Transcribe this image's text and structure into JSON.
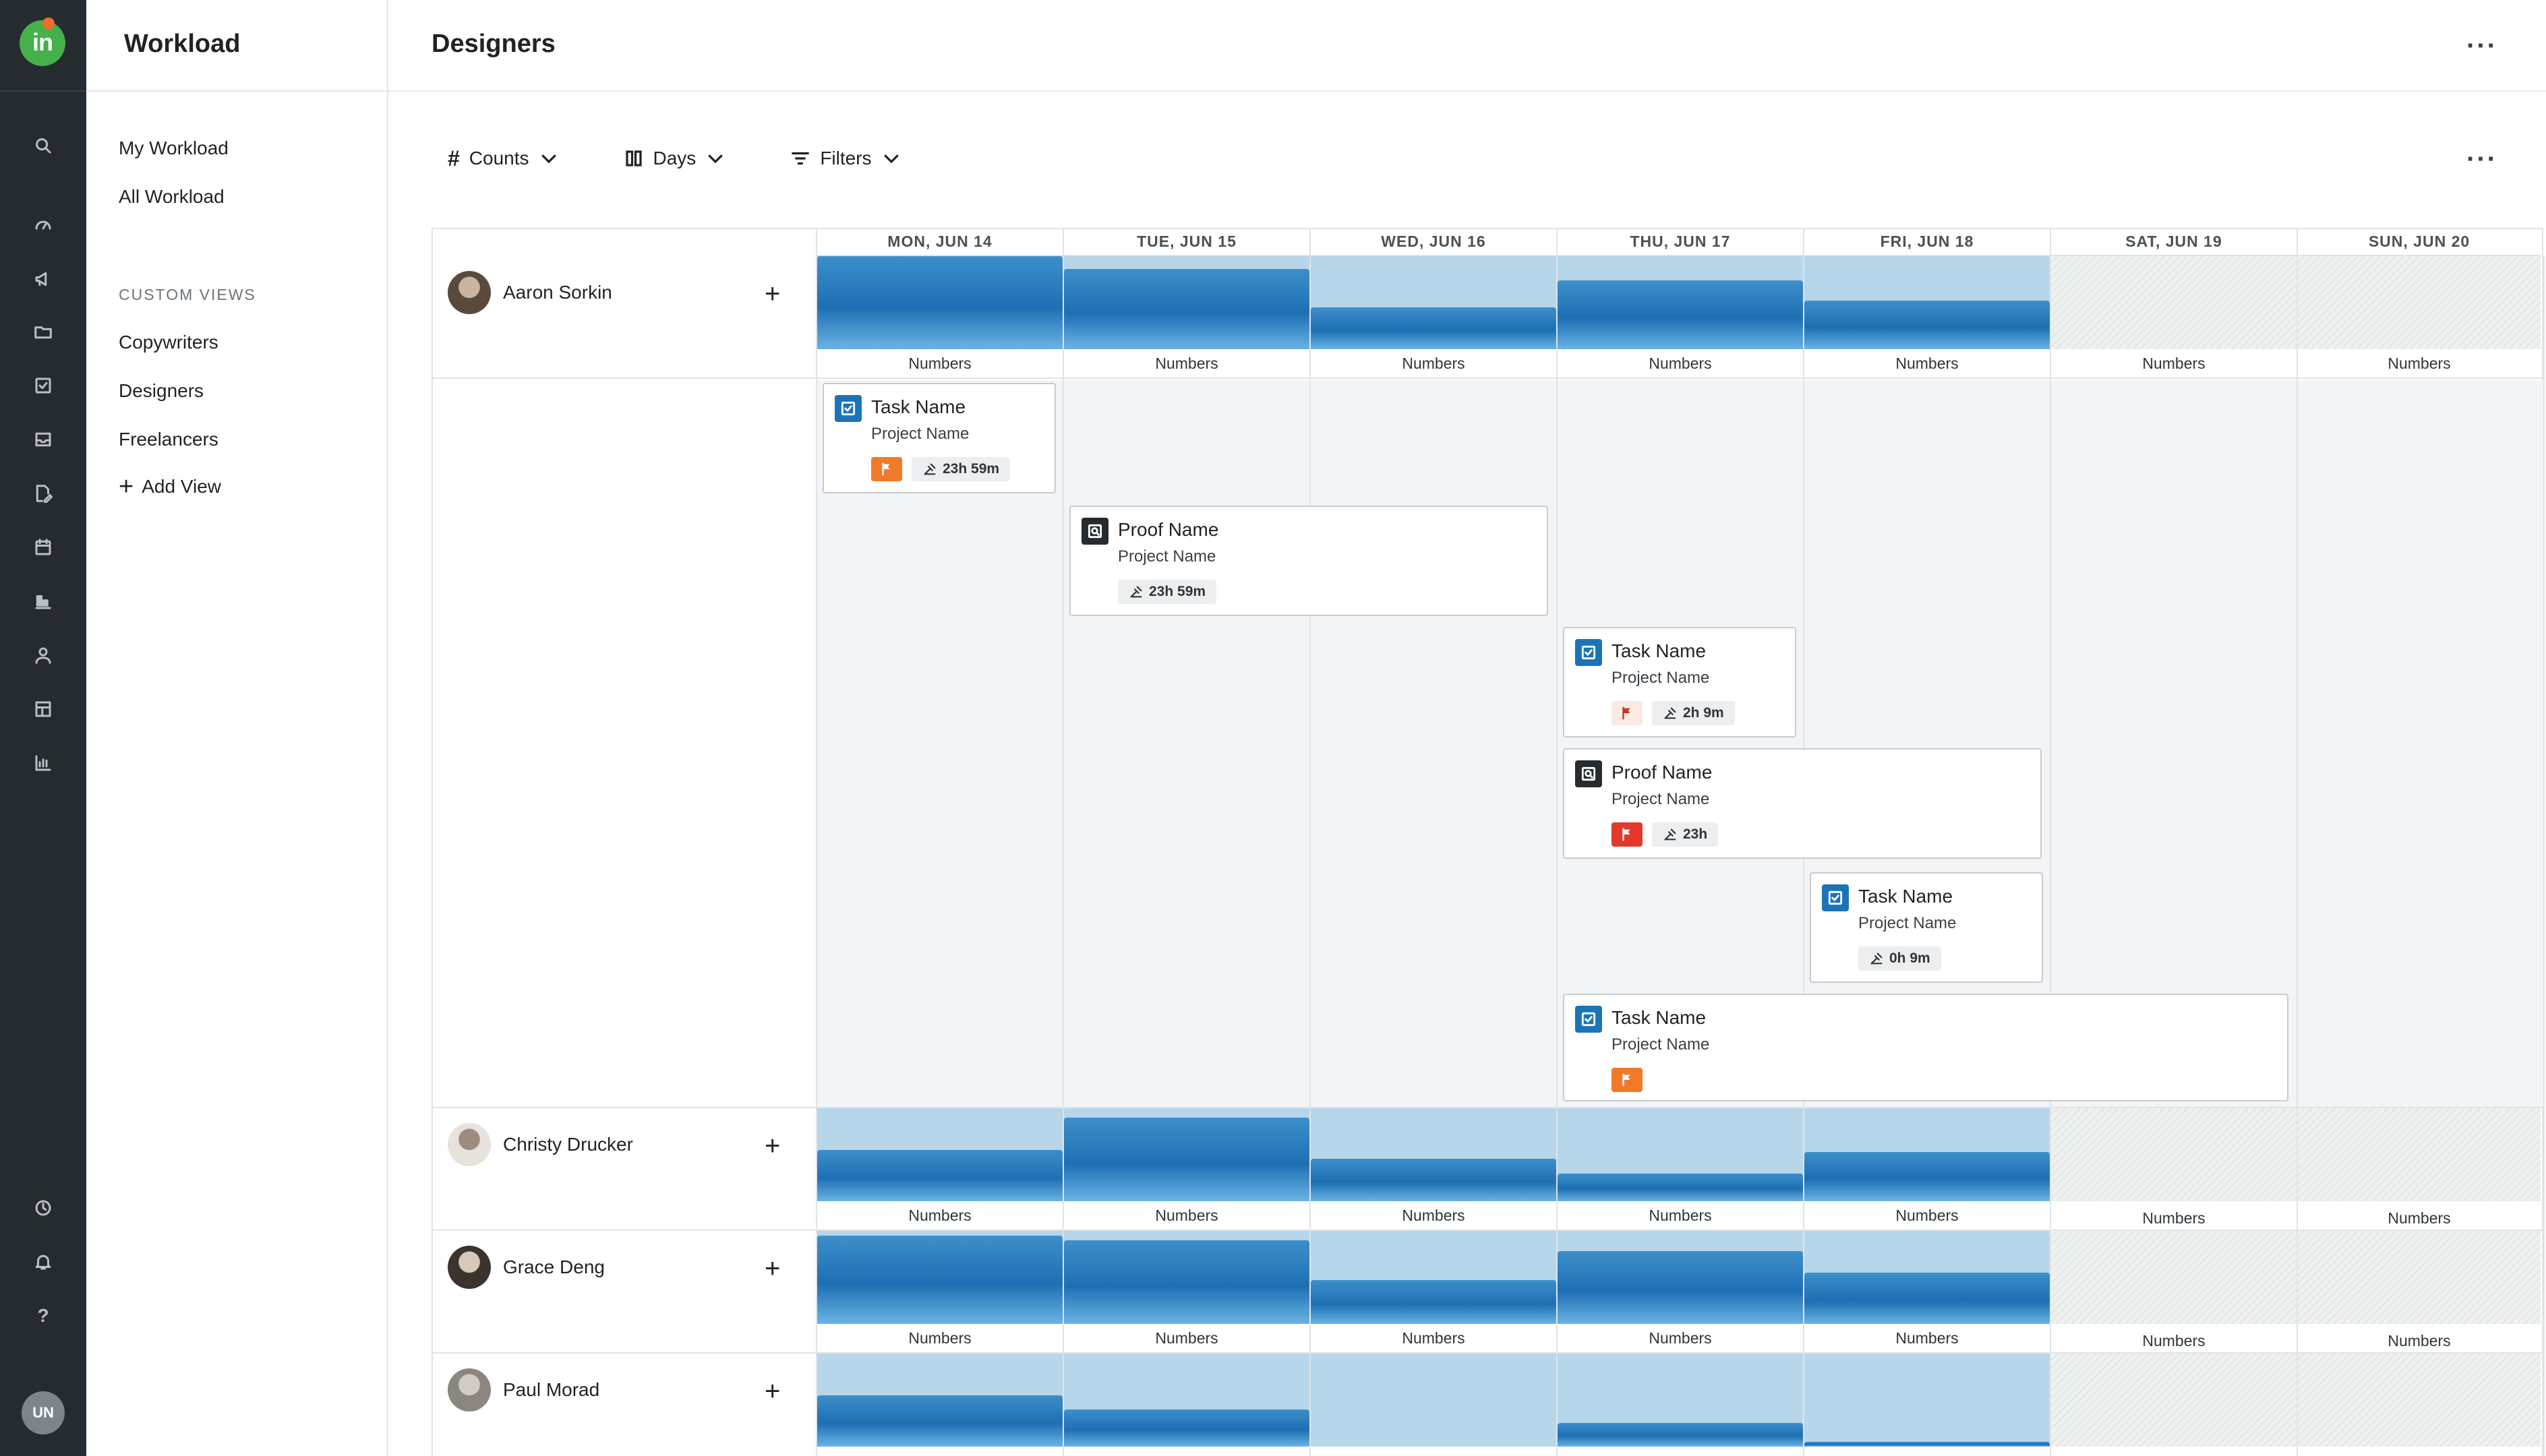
{
  "app": {
    "logo_text": "in"
  },
  "rail": {
    "icons": [
      "search-icon",
      "dashboard-icon",
      "megaphone-icon",
      "folder-icon",
      "task-check-icon",
      "inbox-icon",
      "proof-edit-icon",
      "calendar-icon",
      "workload-icon",
      "person-icon",
      "layout-icon",
      "reports-icon"
    ],
    "bottom_icons": [
      "clock-icon",
      "bell-icon",
      "help-icon"
    ],
    "help_glyph": "?",
    "user_initials": "UN"
  },
  "sidebar": {
    "title": "Workload",
    "items": [
      {
        "label": "My Workload"
      },
      {
        "label": "All Workload"
      }
    ],
    "section_label": "CUSTOM VIEWS",
    "views": [
      {
        "label": "Copywriters"
      },
      {
        "label": "Designers"
      },
      {
        "label": "Freelancers"
      }
    ],
    "add_view_label": "Add View",
    "add_view_glyph": "+"
  },
  "header": {
    "title": "Designers",
    "more_glyph": "···"
  },
  "toolbar": {
    "counts_label": "Counts",
    "counts_glyph": "#",
    "days_label": "Days",
    "filters_label": "Filters",
    "more_glyph": "···"
  },
  "days": [
    "MON, JUN 14",
    "TUE, JUN 15",
    "WED, JUN 16",
    "THU, JUN 17",
    "FRI, JUN 18",
    "SAT, JUN 19",
    "SUN, JUN 20"
  ],
  "people": [
    {
      "name": "Aaron Sorkin",
      "load": [
        1.0,
        0.86,
        0.45,
        0.74,
        0.52
      ],
      "labels": [
        "Numbers",
        "Numbers",
        "Numbers",
        "Numbers",
        "Numbers",
        "Numbers",
        "Numbers"
      ]
    },
    {
      "name": "Christy Drucker",
      "load": [
        0.55,
        0.9,
        0.46,
        0.3,
        0.53
      ],
      "labels": [
        "Numbers",
        "Numbers",
        "Numbers",
        "Numbers",
        "Numbers",
        "Numbers",
        "Numbers"
      ]
    },
    {
      "name": "Grace Deng",
      "load": [
        0.95,
        0.9,
        0.47,
        0.78,
        0.55
      ],
      "labels": [
        "Numbers",
        "Numbers",
        "Numbers",
        "Numbers",
        "Numbers",
        "Numbers",
        "Numbers"
      ]
    },
    {
      "name": "Paul Morad",
      "load": [
        0.55,
        0.4,
        0.0,
        0.25,
        0.05
      ],
      "labels": []
    }
  ],
  "add_glyph": "+",
  "cards": [
    {
      "type": "task",
      "name": "Task Name",
      "project": "Project Name",
      "flag": "orange",
      "duration": "23h 59m"
    },
    {
      "type": "proof",
      "name": "Proof Name",
      "project": "Project Name",
      "flag": "",
      "duration": "23h 59m"
    },
    {
      "type": "task",
      "name": "Task Name",
      "project": "Project Name",
      "flag": "light",
      "duration": "2h 9m"
    },
    {
      "type": "proof",
      "name": "Proof Name",
      "project": "Project Name",
      "flag": "red",
      "duration": "23h"
    },
    {
      "type": "task",
      "name": "Task Name",
      "project": "Project Name",
      "flag": "",
      "duration": "0h 9m"
    },
    {
      "type": "task",
      "name": "Task Name",
      "project": "Project Name",
      "flag": "orange",
      "duration": ""
    }
  ],
  "colors": {
    "accent": "#1b74b8",
    "rail": "#262b2f",
    "flag_orange": "#f07a2a",
    "flag_red": "#e2392b",
    "load_light": "#b7d6ea"
  }
}
